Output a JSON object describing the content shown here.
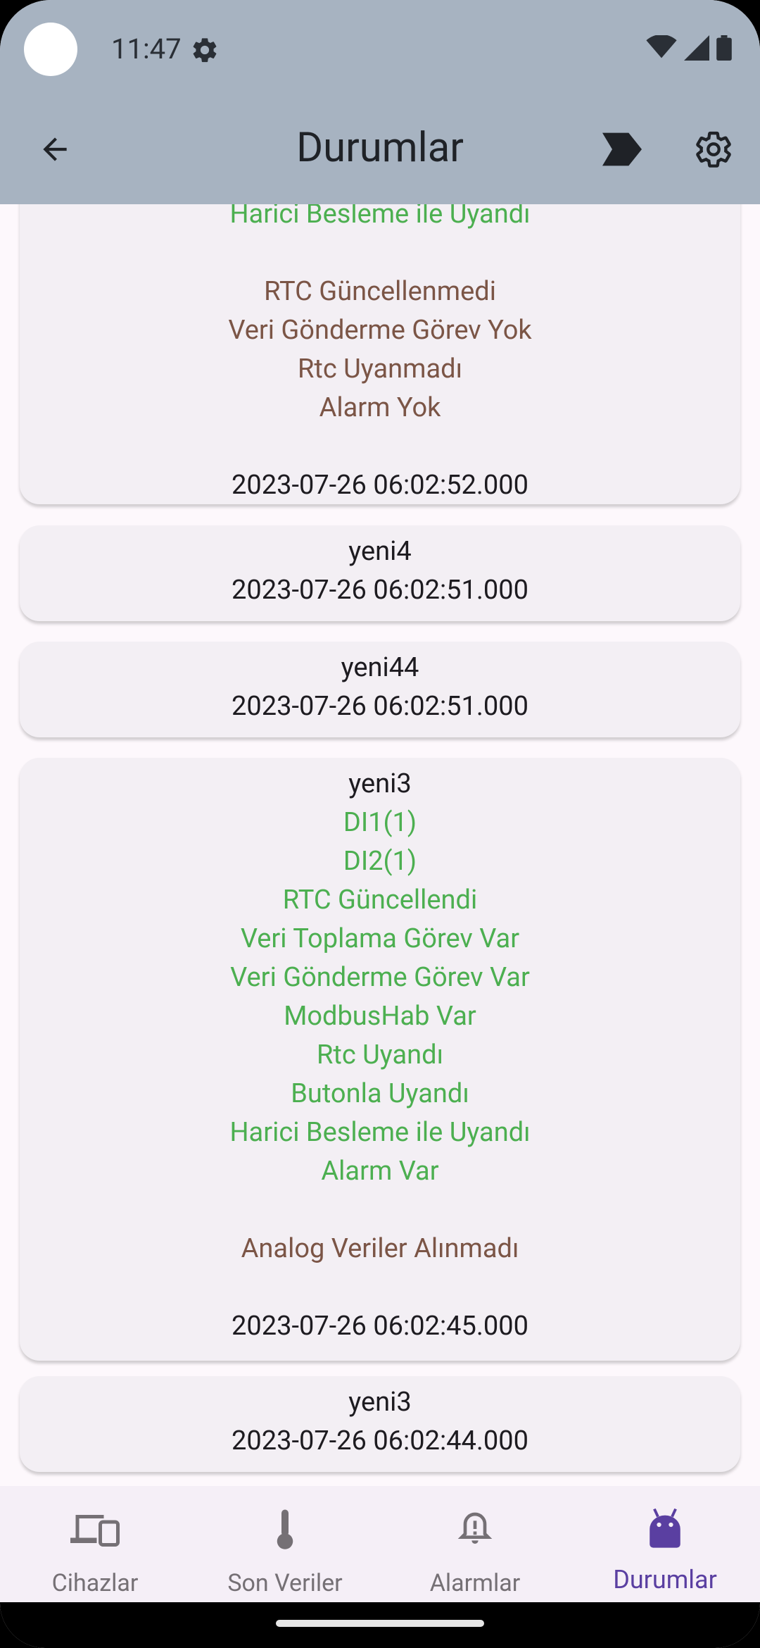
{
  "status_bar": {
    "time": "11:47"
  },
  "app_bar": {
    "title": "Durumlar"
  },
  "cards": [
    {
      "lines": [
        {
          "text": "Harici Besleme ile Uyandı",
          "kind": "ok"
        },
        {
          "text": "",
          "kind": "gap"
        },
        {
          "text": "RTC Güncellenmedi",
          "kind": "warn"
        },
        {
          "text": "Veri Gönderme Görev Yok",
          "kind": "warn"
        },
        {
          "text": "Rtc Uyanmadı",
          "kind": "warn"
        },
        {
          "text": "Alarm Yok",
          "kind": "warn"
        },
        {
          "text": "",
          "kind": "gap"
        }
      ],
      "timestamp": "2023-07-26 06:02:52.000"
    },
    {
      "name": "yeni4",
      "timestamp": "2023-07-26 06:02:51.000"
    },
    {
      "name": "yeni44",
      "timestamp": "2023-07-26 06:02:51.000"
    },
    {
      "name": "yeni3",
      "lines": [
        {
          "text": "DI1(1)",
          "kind": "ok"
        },
        {
          "text": "DI2(1)",
          "kind": "ok"
        },
        {
          "text": "RTC Güncellendi",
          "kind": "ok"
        },
        {
          "text": "Veri Toplama Görev Var",
          "kind": "ok"
        },
        {
          "text": "Veri Gönderme Görev Var",
          "kind": "ok"
        },
        {
          "text": "ModbusHab Var",
          "kind": "ok"
        },
        {
          "text": "Rtc Uyandı",
          "kind": "ok"
        },
        {
          "text": "Butonla Uyandı",
          "kind": "ok"
        },
        {
          "text": "Harici Besleme ile Uyandı",
          "kind": "ok"
        },
        {
          "text": "Alarm Var",
          "kind": "ok"
        },
        {
          "text": "",
          "kind": "gap"
        },
        {
          "text": "Analog Veriler Alınmadı",
          "kind": "warn"
        },
        {
          "text": "",
          "kind": "gap"
        }
      ],
      "timestamp": "2023-07-26 06:02:45.000"
    },
    {
      "name": "yeni3",
      "timestamp": "2023-07-26 06:02:44.000"
    }
  ],
  "bottom_nav": {
    "items": [
      {
        "label": "Cihazlar",
        "icon": "devices-icon",
        "active": false
      },
      {
        "label": "Son Veriler",
        "icon": "thermometer-icon",
        "active": false
      },
      {
        "label": "Alarmlar",
        "icon": "alarm-bell-icon",
        "active": false
      },
      {
        "label": "Durumlar",
        "icon": "android-icon",
        "active": true
      }
    ]
  },
  "colors": {
    "app_bar": "#a7b3c1",
    "ok_text": "#4caf50",
    "warn_text": "#7b5546",
    "active_nav": "#5a3fa1"
  }
}
